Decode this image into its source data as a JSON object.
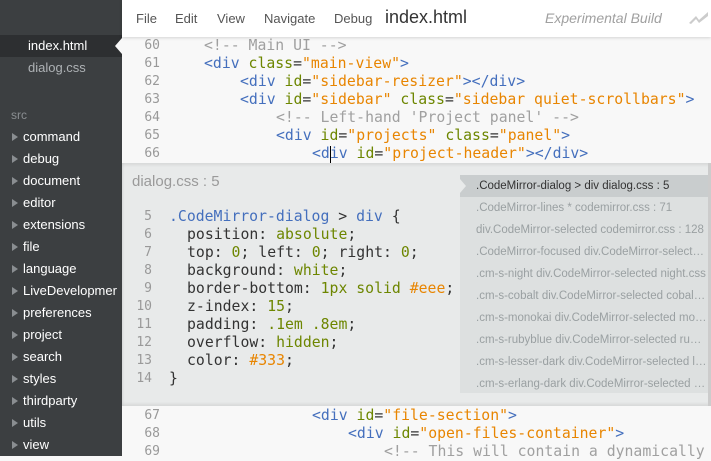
{
  "sidebar": {
    "working_files": [
      {
        "label": "index.html",
        "selected": true
      },
      {
        "label": "dialog.css",
        "selected": false
      }
    ],
    "section_label": "src",
    "folders": [
      "command",
      "debug",
      "document",
      "editor",
      "extensions",
      "file",
      "language",
      "LiveDevelopmer",
      "preferences",
      "project",
      "search",
      "styles",
      "thirdparty",
      "utils",
      "view"
    ]
  },
  "menubar": {
    "items": [
      "File",
      "Edit",
      "View",
      "Navigate",
      "Debug"
    ],
    "title": "index.html",
    "build": "Experimental Build",
    "live_icon": "live-preview-icon"
  },
  "editor_top": [
    {
      "n": "60",
      "indent": 4,
      "t": [
        [
          "cmt",
          "<!-- Main UI -->"
        ]
      ]
    },
    {
      "n": "61",
      "indent": 4,
      "t": [
        [
          "tag",
          "<div "
        ],
        [
          "attr",
          "class"
        ],
        [
          "txt",
          "="
        ],
        [
          "str",
          "\"main-view\""
        ],
        [
          "tag",
          ">"
        ]
      ]
    },
    {
      "n": "62",
      "indent": 8,
      "t": [
        [
          "tag",
          "<div "
        ],
        [
          "attr",
          "id"
        ],
        [
          "txt",
          "="
        ],
        [
          "str",
          "\"sidebar-resizer\""
        ],
        [
          "tag",
          "></div>"
        ]
      ]
    },
    {
      "n": "63",
      "indent": 8,
      "t": [
        [
          "tag",
          "<div "
        ],
        [
          "attr",
          "id"
        ],
        [
          "txt",
          "="
        ],
        [
          "str",
          "\"sidebar\""
        ],
        [
          "txt",
          " "
        ],
        [
          "attr",
          "class"
        ],
        [
          "txt",
          "="
        ],
        [
          "str",
          "\"sidebar quiet-scrollbars\""
        ],
        [
          "tag",
          ">"
        ]
      ]
    },
    {
      "n": "64",
      "indent": 12,
      "t": [
        [
          "cmt",
          "<!-- Left-hand 'Project panel' -->"
        ]
      ]
    },
    {
      "n": "65",
      "indent": 12,
      "t": [
        [
          "tag",
          "<div "
        ],
        [
          "attr",
          "id"
        ],
        [
          "txt",
          "="
        ],
        [
          "str",
          "\"projects\""
        ],
        [
          "txt",
          " "
        ],
        [
          "attr",
          "class"
        ],
        [
          "txt",
          "="
        ],
        [
          "str",
          "\"panel\""
        ],
        [
          "tag",
          ">"
        ]
      ]
    },
    {
      "n": "66",
      "indent": 16,
      "t": [
        [
          "tag",
          "<div "
        ],
        [
          "attr",
          "id"
        ],
        [
          "txt",
          "="
        ],
        [
          "str",
          "\"project-header\""
        ],
        [
          "tag",
          "></div>"
        ]
      ]
    }
  ],
  "inline_editor": {
    "header": "dialog.css : 5",
    "lines": [
      {
        "n": "5",
        "indent": 0,
        "t": [
          [
            "sel2",
            ".CodeMirror-dialog"
          ],
          [
            "txt",
            " > "
          ],
          [
            "sel2",
            "div"
          ],
          [
            "txt",
            " {"
          ]
        ]
      },
      {
        "n": "6",
        "indent": 2,
        "t": [
          [
            "txt",
            "position: "
          ],
          [
            "val",
            "absolute"
          ],
          [
            "txt",
            ";"
          ]
        ]
      },
      {
        "n": "7",
        "indent": 2,
        "t": [
          [
            "txt",
            "top: "
          ],
          [
            "val",
            "0"
          ],
          [
            "txt",
            "; left: "
          ],
          [
            "val",
            "0"
          ],
          [
            "txt",
            "; right: "
          ],
          [
            "val",
            "0"
          ],
          [
            "txt",
            ";"
          ]
        ]
      },
      {
        "n": "8",
        "indent": 2,
        "t": [
          [
            "txt",
            "background: "
          ],
          [
            "val",
            "white"
          ],
          [
            "txt",
            ";"
          ]
        ]
      },
      {
        "n": "9",
        "indent": 2,
        "t": [
          [
            "txt",
            "border-bottom: "
          ],
          [
            "val",
            "1px solid "
          ],
          [
            "hex",
            "#eee"
          ],
          [
            "txt",
            ";"
          ]
        ]
      },
      {
        "n": "10",
        "indent": 2,
        "t": [
          [
            "txt",
            "z-index: "
          ],
          [
            "val",
            "15"
          ],
          [
            "txt",
            ";"
          ]
        ]
      },
      {
        "n": "11",
        "indent": 2,
        "t": [
          [
            "txt",
            "padding: "
          ],
          [
            "val",
            ".1em .8em"
          ],
          [
            "txt",
            ";"
          ]
        ]
      },
      {
        "n": "12",
        "indent": 2,
        "t": [
          [
            "txt",
            "overflow: "
          ],
          [
            "val",
            "hidden"
          ],
          [
            "txt",
            ";"
          ]
        ]
      },
      {
        "n": "13",
        "indent": 2,
        "t": [
          [
            "txt",
            "color: "
          ],
          [
            "hex",
            "#333"
          ],
          [
            "txt",
            ";"
          ]
        ]
      },
      {
        "n": "14",
        "indent": 0,
        "t": [
          [
            "txt",
            "}"
          ]
        ]
      }
    ],
    "rules": [
      ".CodeMirror-dialog > div dialog.css : 5",
      ".CodeMirror-lines * codemirror.css : 71",
      "div.CodeMirror-selected codemirror.css : 128",
      ".CodeMirror-focused div.CodeMirror-selected codemirror.css",
      ".cm-s-night div.CodeMirror-selected night.css",
      ".cm-s-cobalt div.CodeMirror-selected cobalt.css",
      ".cm-s-monokai div.CodeMirror-selected monokai.css",
      ".cm-s-rubyblue div.CodeMirror-selected rubyblue.css",
      ".cm-s-lesser-dark div.CodeMirror-selected lesser-dark.css",
      ".cm-s-erlang-dark div.CodeMirror-selected erlang-dark.css"
    ]
  },
  "editor_bottom": [
    {
      "n": "67",
      "indent": 16,
      "t": [
        [
          "tag",
          "<div "
        ],
        [
          "attr",
          "id"
        ],
        [
          "txt",
          "="
        ],
        [
          "str",
          "\"file-section\""
        ],
        [
          "tag",
          ">"
        ]
      ]
    },
    {
      "n": "68",
      "indent": 20,
      "t": [
        [
          "tag",
          "<div "
        ],
        [
          "attr",
          "id"
        ],
        [
          "txt",
          "="
        ],
        [
          "str",
          "\"open-files-container\""
        ],
        [
          "tag",
          ">"
        ]
      ]
    },
    {
      "n": "69",
      "indent": 24,
      "t": [
        [
          "cmt",
          "<!-- This will contain a dynamically"
        ]
      ]
    }
  ]
}
